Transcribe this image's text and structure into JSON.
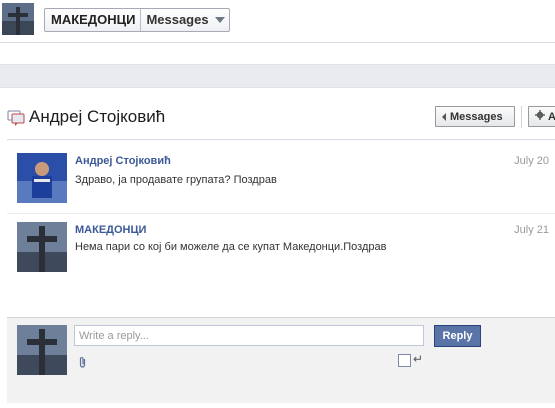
{
  "header": {
    "page_name": "МАКЕДОНЦИ",
    "section_label": "Messages"
  },
  "thread": {
    "title": "Андреј Стојковић",
    "messages_button": "Messages",
    "actions_button_partial": "A"
  },
  "messages": [
    {
      "sender": "Андреј Стојковић",
      "date": "July 20",
      "text": "Здраво, ја продавате групата? Поздрав"
    },
    {
      "sender": "МАКЕДОНЦИ",
      "date": "July 21",
      "text": "Нема пари со кој би можеле да се купат Македонци.Поздрав"
    }
  ],
  "composer": {
    "placeholder": "Write a reply...",
    "reply_button": "Reply",
    "enter_glyph": "↵"
  },
  "colors": {
    "link_blue": "#3b5998",
    "reply_button_bg": "#5b74a8",
    "band_grey": "#e9ebee"
  },
  "icons": {
    "thread": "messages-bubble-icon",
    "actions": "gear-icon",
    "attach": "paperclip-icon"
  }
}
